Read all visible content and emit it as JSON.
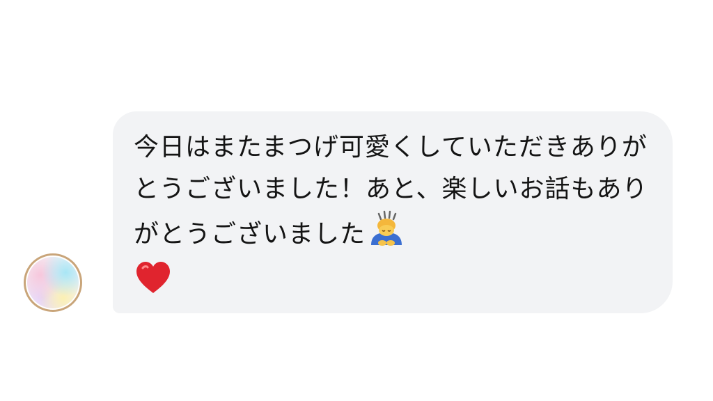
{
  "message": {
    "text": "今日はまたまつげ可愛くしていただきありがとうございました！あと、楽しいお話もありがとうございました",
    "trailing_emojis": [
      "person-bowing-icon",
      "red-heart-icon"
    ]
  },
  "sender": {
    "avatar": "avatar-gradient"
  },
  "colors": {
    "bubble_bg": "#f2f3f5",
    "text": "#141414",
    "heart": "#e0242e",
    "avatar_ring": "#c9a57a"
  }
}
